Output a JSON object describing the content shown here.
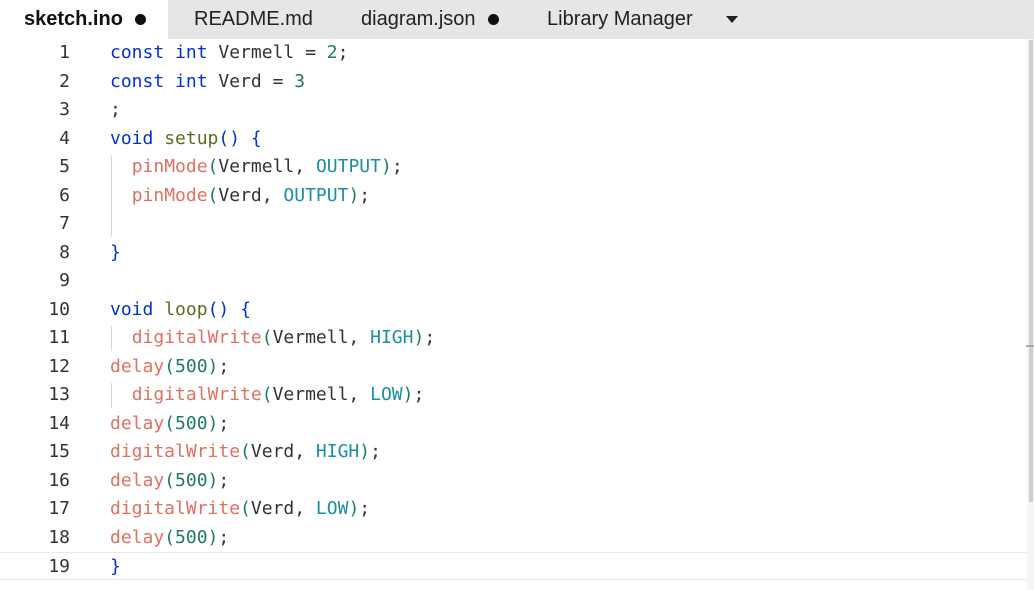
{
  "tabs": [
    {
      "label": "sketch.ino",
      "modified": true,
      "active": true
    },
    {
      "label": "README.md",
      "modified": false,
      "active": false
    },
    {
      "label": "diagram.json",
      "modified": true,
      "active": false
    },
    {
      "label": "Library Manager",
      "modified": false,
      "active": false
    }
  ],
  "tab_menu_icon": "chevron-down-icon",
  "editor": {
    "language": "arduino",
    "current_line": 19,
    "lines": [
      {
        "n": "1",
        "tokens": [
          {
            "t": "const",
            "c": "kw"
          },
          {
            "t": " "
          },
          {
            "t": "int",
            "c": "kw"
          },
          {
            "t": " Vermell = "
          },
          {
            "t": "2",
            "c": "num"
          },
          {
            "t": ";"
          }
        ]
      },
      {
        "n": "2",
        "tokens": [
          {
            "t": "const",
            "c": "kw"
          },
          {
            "t": " "
          },
          {
            "t": "int",
            "c": "kw"
          },
          {
            "t": " Verd = "
          },
          {
            "t": "3",
            "c": "num"
          }
        ]
      },
      {
        "n": "3",
        "tokens": [
          {
            "t": ";"
          }
        ]
      },
      {
        "n": "4",
        "tokens": [
          {
            "t": "void",
            "c": "kw"
          },
          {
            "t": " "
          },
          {
            "t": "setup",
            "c": "user"
          },
          {
            "t": "()",
            "c": "br"
          },
          {
            "t": " "
          },
          {
            "t": "{",
            "c": "br"
          }
        ]
      },
      {
        "n": "5",
        "tokens": [
          {
            "t": "  "
          },
          {
            "t": "pinMode",
            "c": "fn"
          },
          {
            "t": "(",
            "c": "num"
          },
          {
            "t": "Vermell, "
          },
          {
            "t": "OUTPUT",
            "c": "const"
          },
          {
            "t": ")",
            "c": "num"
          },
          {
            "t": ";"
          }
        ]
      },
      {
        "n": "6",
        "tokens": [
          {
            "t": "  "
          },
          {
            "t": "pinMode",
            "c": "fn"
          },
          {
            "t": "(",
            "c": "num"
          },
          {
            "t": "Verd, "
          },
          {
            "t": "OUTPUT",
            "c": "const"
          },
          {
            "t": ")",
            "c": "num"
          },
          {
            "t": ";"
          }
        ]
      },
      {
        "n": "7",
        "tokens": []
      },
      {
        "n": "8",
        "tokens": [
          {
            "t": "}",
            "c": "br"
          }
        ]
      },
      {
        "n": "9",
        "tokens": []
      },
      {
        "n": "10",
        "tokens": [
          {
            "t": "void",
            "c": "kw"
          },
          {
            "t": " "
          },
          {
            "t": "loop",
            "c": "user"
          },
          {
            "t": "()",
            "c": "br"
          },
          {
            "t": " "
          },
          {
            "t": "{",
            "c": "br"
          }
        ]
      },
      {
        "n": "11",
        "tokens": [
          {
            "t": "  "
          },
          {
            "t": "digitalWrite",
            "c": "fn"
          },
          {
            "t": "(",
            "c": "num"
          },
          {
            "t": "Vermell, "
          },
          {
            "t": "HIGH",
            "c": "const"
          },
          {
            "t": ")",
            "c": "num"
          },
          {
            "t": ";"
          }
        ]
      },
      {
        "n": "12",
        "tokens": [
          {
            "t": "delay",
            "c": "fn"
          },
          {
            "t": "(",
            "c": "num"
          },
          {
            "t": "500",
            "c": "num"
          },
          {
            "t": ")",
            "c": "num"
          },
          {
            "t": ";"
          }
        ]
      },
      {
        "n": "13",
        "tokens": [
          {
            "t": "  "
          },
          {
            "t": "digitalWrite",
            "c": "fn"
          },
          {
            "t": "(",
            "c": "num"
          },
          {
            "t": "Vermell, "
          },
          {
            "t": "LOW",
            "c": "const"
          },
          {
            "t": ")",
            "c": "num"
          },
          {
            "t": ";"
          }
        ]
      },
      {
        "n": "14",
        "tokens": [
          {
            "t": "delay",
            "c": "fn"
          },
          {
            "t": "(",
            "c": "num"
          },
          {
            "t": "500",
            "c": "num"
          },
          {
            "t": ")",
            "c": "num"
          },
          {
            "t": ";"
          }
        ]
      },
      {
        "n": "15",
        "tokens": [
          {
            "t": "digitalWrite",
            "c": "fn"
          },
          {
            "t": "(",
            "c": "num"
          },
          {
            "t": "Verd, "
          },
          {
            "t": "HIGH",
            "c": "const"
          },
          {
            "t": ")",
            "c": "num"
          },
          {
            "t": ";"
          }
        ]
      },
      {
        "n": "16",
        "tokens": [
          {
            "t": "delay",
            "c": "fn"
          },
          {
            "t": "(",
            "c": "num"
          },
          {
            "t": "500",
            "c": "num"
          },
          {
            "t": ")",
            "c": "num"
          },
          {
            "t": ";"
          }
        ]
      },
      {
        "n": "17",
        "tokens": [
          {
            "t": "digitalWrite",
            "c": "fn"
          },
          {
            "t": "(",
            "c": "num"
          },
          {
            "t": "Verd, "
          },
          {
            "t": "LOW",
            "c": "const"
          },
          {
            "t": ")",
            "c": "num"
          },
          {
            "t": ";"
          }
        ]
      },
      {
        "n": "18",
        "tokens": [
          {
            "t": "delay",
            "c": "fn"
          },
          {
            "t": "(",
            "c": "num"
          },
          {
            "t": "500",
            "c": "num"
          },
          {
            "t": ")",
            "c": "num"
          },
          {
            "t": ";"
          }
        ]
      },
      {
        "n": "19",
        "tokens": [
          {
            "t": "}",
            "c": "br"
          }
        ]
      }
    ]
  },
  "colors": {
    "keyword": "#0033cc",
    "builtin_function": "#e07060",
    "user_function": "#5a6d1e",
    "number_and_parens": "#1e7a62",
    "constant": "#1b8ea3",
    "tab_bar": "#e6e6e6"
  }
}
